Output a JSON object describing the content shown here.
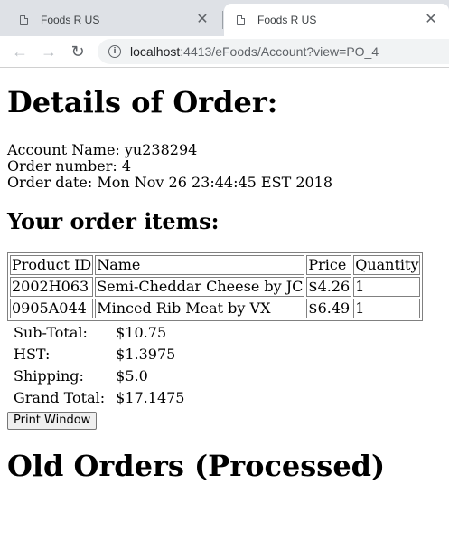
{
  "browser": {
    "tabs": [
      {
        "title": "Foods R US"
      },
      {
        "title": "Foods R US"
      }
    ],
    "url_host": "localhost",
    "url_rest": ":4413/eFoods/Account?view=PO_4"
  },
  "page": {
    "heading": "Details of Order:",
    "account_line": "Account Name: yu238294",
    "order_number_line": "Order number: 4",
    "order_date_line": "Order date: Mon Nov 26 23:44:45 EST 2018",
    "items_heading": "Your order items:",
    "table": {
      "headers": [
        "Product ID",
        "Name",
        "Price",
        "Quantity"
      ],
      "rows": [
        [
          "2002H063",
          "Semi-Cheddar Cheese by JC",
          "$4.26",
          "1"
        ],
        [
          "0905A044",
          "Minced Rib Meat by VX",
          "$6.49",
          "1"
        ]
      ]
    },
    "totals": [
      {
        "label": "Sub-Total:",
        "value": "$10.75"
      },
      {
        "label": "HST:",
        "value": "$1.3975"
      },
      {
        "label": "Shipping:",
        "value": "$5.0"
      },
      {
        "label": "Grand Total:",
        "value": "$17.1475"
      }
    ],
    "print_button": "Print Window",
    "old_orders_heading": "Old Orders (Processed)"
  }
}
